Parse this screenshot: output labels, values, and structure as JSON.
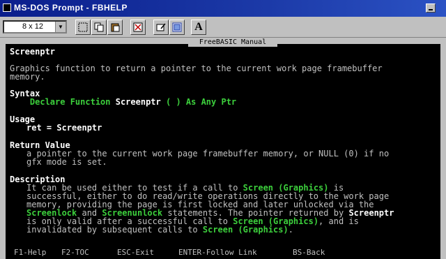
{
  "window": {
    "title": "MS-DOS Prompt - FBHELP"
  },
  "toolbar": {
    "font_size": "8 x 12",
    "font_button": "A"
  },
  "help": {
    "header": "FreeBASIC Manual",
    "topic": "Screenptr",
    "description": [
      "Graphics function to return a pointer to the current work page framebuffer",
      "memory."
    ],
    "syntax_heading": "Syntax",
    "syntax": {
      "declare": "Declare Function",
      "name": "Screenptr",
      "args": "( ) As Any Ptr"
    },
    "usage_heading": "Usage",
    "usage": "ret = Screenptr",
    "return_heading": "Return Value",
    "return_lines": [
      "a pointer to the current work page framebuffer memory, or NULL (0) if no",
      "gfx mode is set."
    ],
    "desc_heading": "Description",
    "desc": {
      "l1a": "It can be used either to test if a call to",
      "l1link": "Screen (Graphics)",
      "l1b": "is",
      "l2": "successful, either to do read/write operations directly to the work page",
      "l3": "memory, providing the page is first locked and later unlocked via the",
      "l4link1": "Screenlock",
      "l4mid": "and",
      "l4link2": "Screenunlock",
      "l4b": "statements. The pointer returned by",
      "l4link3": "Screenptr",
      "l5a": "is only valid after a successful call to",
      "l5link": "Screen (Graphics)",
      "l5b": ", and is",
      "l6a": "invalidated by subsequent calls to",
      "l6link": "Screen (Graphics)",
      "l6b": "."
    }
  },
  "status": {
    "f1": "F1-Help",
    "f2": "F2-TOC",
    "esc": "ESC-Exit",
    "enter": "ENTER-Follow Link",
    "bs": "BS-Back"
  },
  "icons": [
    "window-icon",
    "minimize-icon",
    "mark-icon",
    "copy-icon",
    "paste-icon",
    "fullscreen-icon",
    "properties-icon",
    "background-icon"
  ]
}
